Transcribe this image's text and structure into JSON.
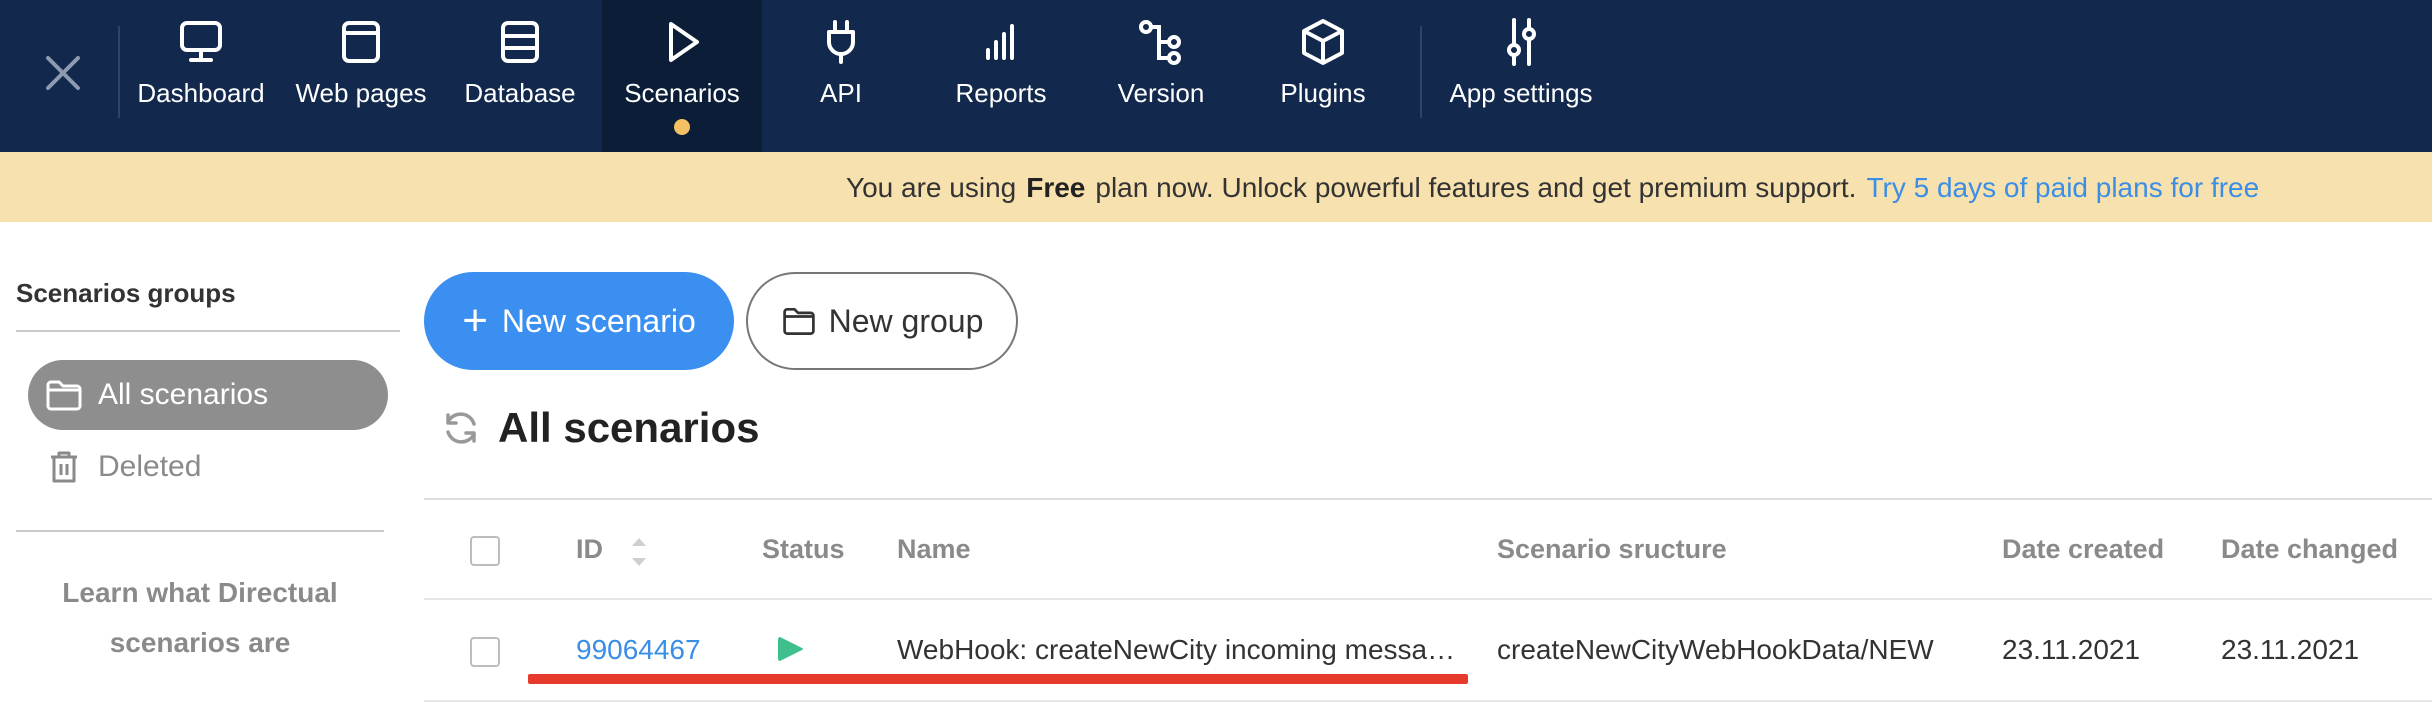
{
  "nav": {
    "close_icon": "close-icon",
    "items": [
      {
        "label": "Dashboard",
        "icon": "monitor-icon"
      },
      {
        "label": "Web pages",
        "icon": "browser-window-icon"
      },
      {
        "label": "Database",
        "icon": "database-icon"
      },
      {
        "label": "Scenarios",
        "icon": "play-icon",
        "active": true
      },
      {
        "label": "API",
        "icon": "plug-icon"
      },
      {
        "label": "Reports",
        "icon": "bar-chart-icon"
      },
      {
        "label": "Version",
        "icon": "git-branch-icon"
      },
      {
        "label": "Plugins",
        "icon": "cube-icon"
      },
      {
        "label": "App settings",
        "icon": "sliders-icon"
      }
    ],
    "active_dot_color": "#f3c163",
    "bg_color": "#12294d"
  },
  "banner": {
    "prefix": "You are using",
    "plan": "Free",
    "suffix": "plan now. Unlock powerful features and get premium support.",
    "link": "Try 5 days of paid plans for free",
    "bg_color": "#f7e1ae",
    "link_color": "#3a8ee6"
  },
  "sidebar": {
    "title": "Scenarios groups",
    "items": [
      {
        "label": "All scenarios",
        "icon": "folder-icon",
        "active": true
      },
      {
        "label": "Deleted",
        "icon": "trash-icon"
      }
    ],
    "learn_line1": "Learn what Directual",
    "learn_line2": "scenarios are"
  },
  "main": {
    "new_scenario_label": "New scenario",
    "new_group_label": "New group",
    "section_title": "All scenarios",
    "accent_color": "#3b8ff0",
    "table": {
      "columns": [
        "ID",
        "Status",
        "Name",
        "Scenario sructure",
        "Date created",
        "Date changed"
      ],
      "rows": [
        {
          "id": "99064467",
          "status": "running",
          "name": "WebHook: createNewCity incoming messa…",
          "structure": "createNewCityWebHookData/NEW",
          "created": "23.11.2021",
          "changed": "23.11.2021"
        }
      ],
      "status_color": "#3fbf8c"
    }
  }
}
